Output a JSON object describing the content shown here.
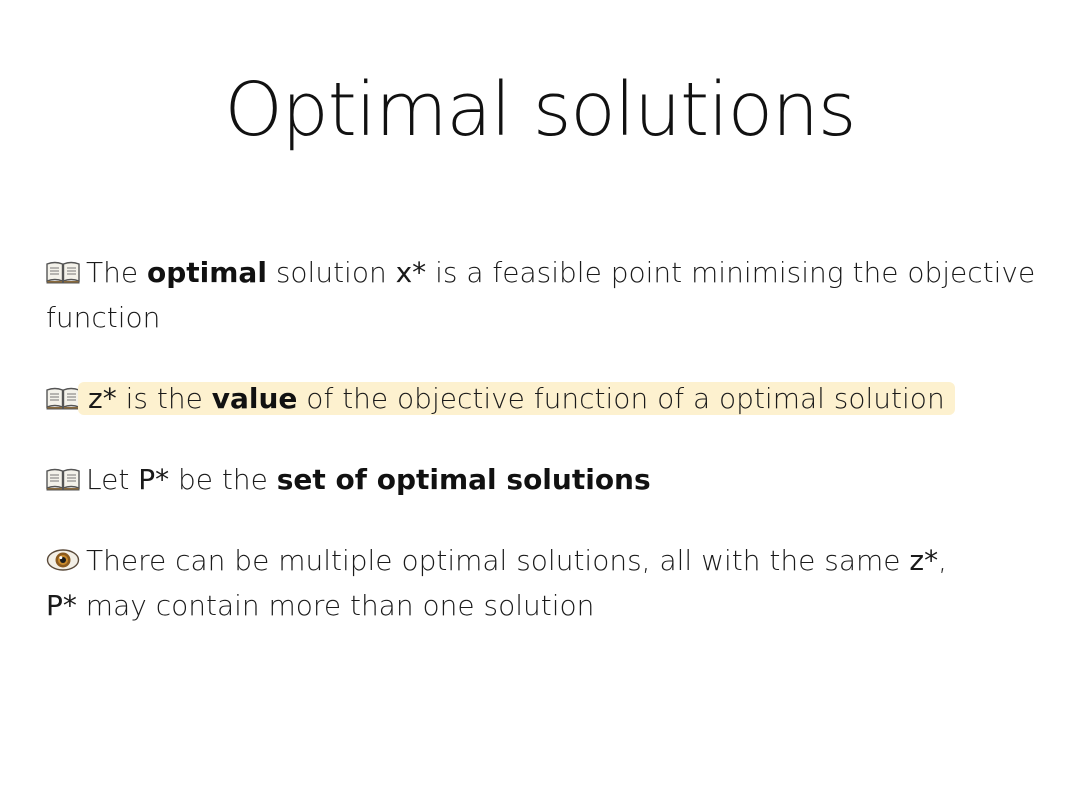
{
  "slide": {
    "title": "Optimal solutions",
    "items": [
      {
        "icon": "open-book-icon",
        "text_before": "The ",
        "bold": "optimal",
        "text_mid": " solution ",
        "math": "x*",
        "text_after": " is a feasible point minimising the objective function"
      },
      {
        "icon": "open-book-icon",
        "math": "z*",
        "text_before": " is the ",
        "bold": "value",
        "text_after": " of the objective function of a optimal solution",
        "highlight_color": "#fdf1cf"
      },
      {
        "icon": "open-book-icon",
        "text_before": "Let ",
        "math": "P*",
        "text_mid": " be the ",
        "bold": "set of optimal solutions"
      },
      {
        "icon": "eye-icon",
        "text_before": "There can be multiple optimal solutions, all with the same ",
        "math": "z*",
        "text_mid": ",",
        "math2": "P*",
        "text_after": " may contain  more than one solution"
      }
    ]
  }
}
